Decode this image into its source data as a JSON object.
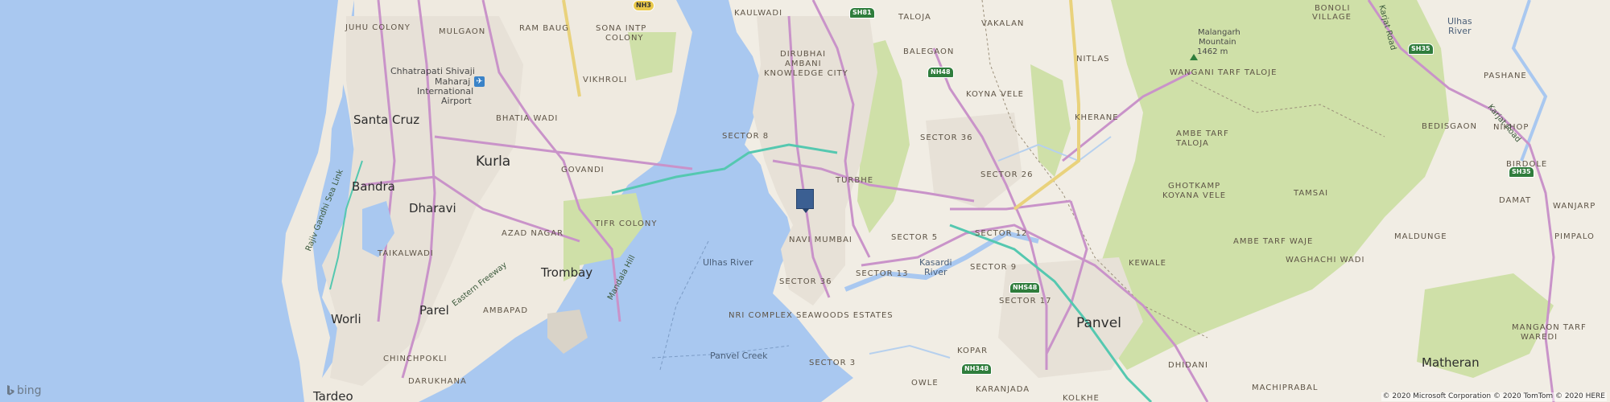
{
  "map": {
    "colors": {
      "water": "#a9c8f0",
      "land": "#f1ede4",
      "forest": "#cfe0a8",
      "urban": "#e7e1d7",
      "arterial": "#c993c9",
      "highway": "#e9d27c",
      "rail": "#55c8b0"
    },
    "places": {
      "kurla": "Kurla",
      "santa_cruz": "Santa Cruz",
      "bandra": "Bandra",
      "dharavi": "Dharavi",
      "trombay": "Trombay",
      "parel": "Parel",
      "worli": "Worli",
      "tardeo": "Tardeo",
      "panvel": "Panvel",
      "matheran": "Matheran"
    },
    "areas": {
      "juhu_colony": "JUHU COLONY",
      "mulgaon": "MULGAON",
      "ram_baug": "RAM BAUG",
      "sona_intp_colony_1": "SONA INTP",
      "sona_intp_colony_2": "COLONY",
      "kaulwadi": "KAULWADI",
      "taloja": "TALOJA",
      "vakalan": "VAKALAN",
      "bonoli_village_1": "BONOLI",
      "bonoli_village_2": "VILLAGE",
      "dirubhai_1": "DIRUBHAI",
      "dirubhai_2": "AMBANI",
      "dirubhai_3": "KNOWLEDGE CITY",
      "balegaon": "BALEGAON",
      "nitlas": "NITLAS",
      "vikhroli": "VIKHROLI",
      "koyna_vele": "KOYNA VELE",
      "wangani_tarf_taloje": "WANGANI TARF TALOJE",
      "pashane": "PASHANE",
      "bhatia_wadi": "BHATIA WADI",
      "kherane": "KHERANE",
      "sector_8": "SECTOR 8",
      "sector_36_north": "SECTOR 36",
      "ambe_tarf_taloja_1": "AMBE TARF",
      "ambe_tarf_taloja_2": "TALOJA",
      "bedisgaon": "BEDISGAON",
      "nikhop": "NIKHOP",
      "govandi": "GOVANDI",
      "sector_26": "SECTOR 26",
      "birdole": "BIRDOLE",
      "turbhe": "TURBHE",
      "ghotkamp_1": "GHOTKAMP",
      "ghotkamp_2": "KOYANA VELE",
      "tamsai": "TAMSAI",
      "damat": "DAMAT",
      "tifr_colony": "TIFR COLONY",
      "wanjarp": "WANJARP",
      "azad_nagar": "AZAD NAGAR",
      "taikalwadi": "TAIKALWADI",
      "navi_mumbai": "NAVI MUMBAI",
      "sector_5": "SECTOR 5",
      "sector_12": "SECTOR 12",
      "ambe_tarf_waje": "AMBE TARF WAJE",
      "maldunge": "MALDUNGE",
      "pimpalo": "PIMPALO",
      "kewale": "KEWALE",
      "sector_13": "SECTOR 13",
      "sector_9": "SECTOR 9",
      "waghachi_wadi": "WAGHACHI WADI",
      "sector_36_south": "SECTOR 36",
      "sector_17": "SECTOR 17",
      "ambapad": "AMBAPAD",
      "nri_complex": "NRI COMPLEX SEAWOODS ESTATES",
      "mangaon_1": "MANGAON TARF",
      "mangaon_2": "WAREDI",
      "chinchpokli": "CHINCHPOKLI",
      "kopar": "KOPAR",
      "sector_3": "SECTOR 3",
      "dhidani": "DHIDANI",
      "owle": "OWLE",
      "darukhana": "DARUKHANA",
      "karanjada": "KARANJADA",
      "machiprabal": "MACHIPRABAL",
      "kolkhe": "KOLKHE"
    },
    "airport": {
      "line1": "Chhatrapati Shivaji",
      "line2": "Maharaj",
      "line3": "International",
      "line4": "Airport"
    },
    "peak": {
      "name": "Malangarh",
      "line2": "Mountain",
      "elevation": "1462 m"
    },
    "water": {
      "ulhas_river_bay": "Ulhas River",
      "ulhas_river_ne": "Ulhas",
      "ulhas_river_ne2": "River",
      "kasardi_river_1": "Kasardi",
      "kasardi_river_2": "River",
      "panvel_creek": "Panvel Creek"
    },
    "roads": {
      "sea_link": "Rajiv Gandhi Sea Link",
      "eastern_freeway": "Eastern Freeway",
      "mandala_hill": "Mandala Hill",
      "karjat_road_1": "Karjat Road",
      "karjat_road_2": "Karjat Road"
    },
    "shields": {
      "sh81": "SH81",
      "nh48": "NH48",
      "sh35_north": "SH35",
      "sh35_south": "SH35",
      "nhs48": "NHS48",
      "nh348": "NH348",
      "top": "NH3"
    },
    "logo": "bing",
    "copyright": "© 2020 Microsoft Corporation © 2020 TomTom © 2020 HERE"
  }
}
